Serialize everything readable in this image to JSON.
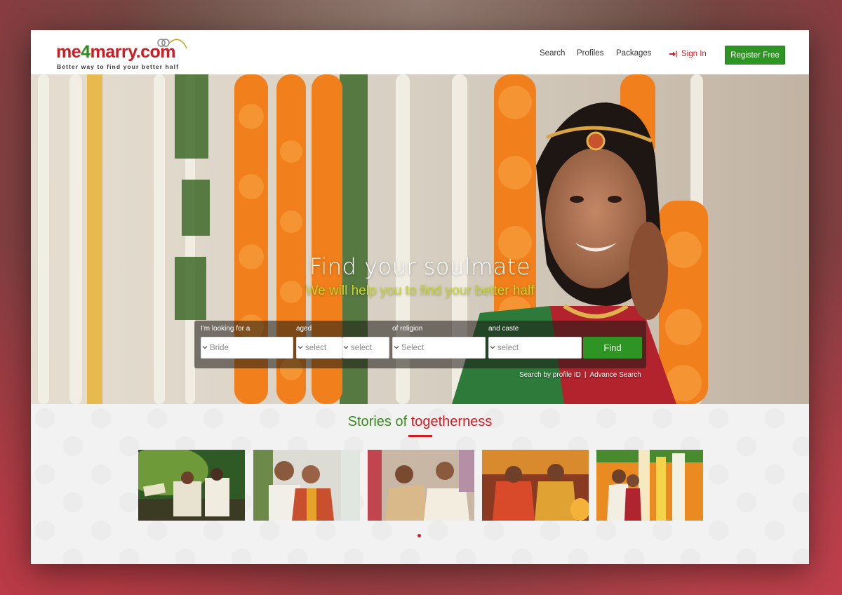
{
  "brand": {
    "name_part1": "me",
    "name_part2": "4",
    "name_part3": "marry.com",
    "tagline": "Better way to find your better half"
  },
  "nav": {
    "items": [
      "Search",
      "Profiles",
      "Packages"
    ],
    "signin_label": "Sign In",
    "register_label": "Register Free"
  },
  "hero": {
    "title": "Find your soulmate",
    "subtitle": "We will help you to find your better half"
  },
  "search": {
    "looking_label": "I'm looking for a",
    "looking_value": "Bride",
    "aged_label": "aged",
    "age_from": "select",
    "age_to": "select",
    "religion_label": "of religion",
    "religion_value": "Select",
    "caste_label": "and caste",
    "caste_value": "select",
    "find_label": "Find",
    "profile_id_link": "Search by profile ID",
    "separator": "|",
    "advance_link": "Advance Search"
  },
  "stories": {
    "title_part1": "Stories of ",
    "title_part2": "togetherness"
  },
  "colors": {
    "brand_red": "#d01b22",
    "brand_green": "#2e9423",
    "subtitle_yellow": "#c7d430"
  }
}
